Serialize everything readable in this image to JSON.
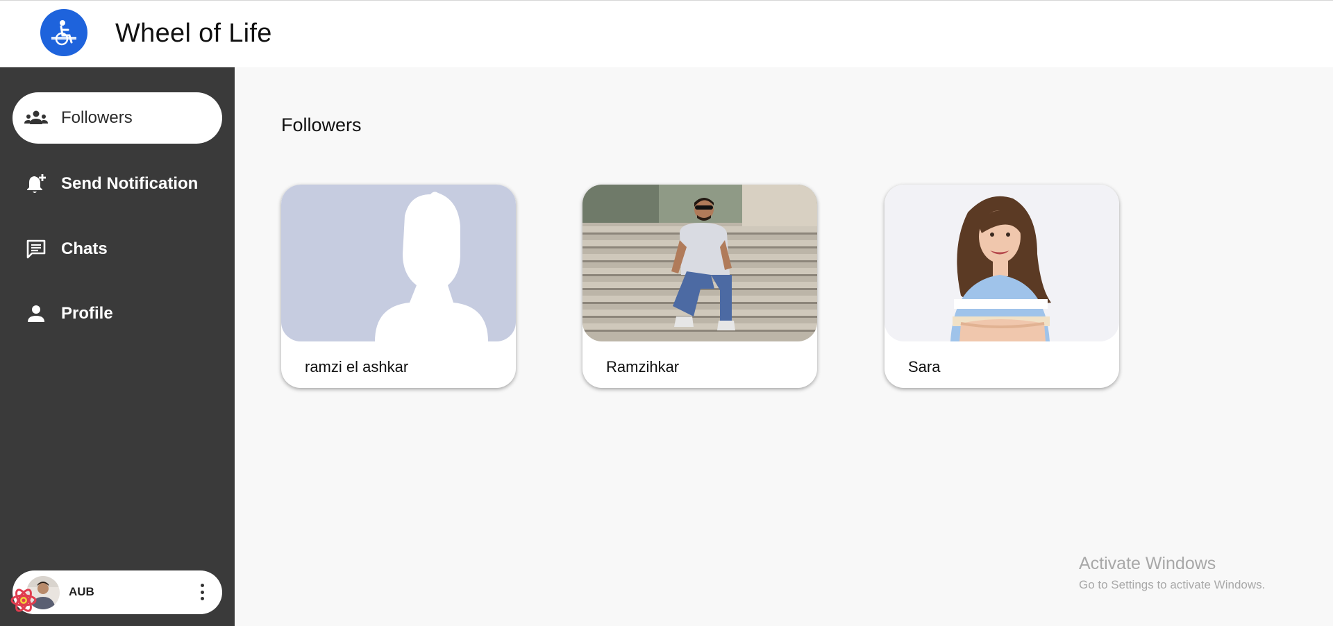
{
  "header": {
    "title": "Wheel of Life",
    "logo_icon": "wheelchair-logo-icon"
  },
  "sidebar": {
    "items": [
      {
        "label": "Followers",
        "icon": "group-icon",
        "active": true
      },
      {
        "label": "Send Notification",
        "icon": "bell-add-icon",
        "active": false
      },
      {
        "label": "Chats",
        "icon": "chat-icon",
        "active": false
      },
      {
        "label": "Profile",
        "icon": "person-icon",
        "active": false
      }
    ],
    "user": {
      "name": "AUB",
      "menu_icon": "more-vertical-icon"
    }
  },
  "main": {
    "title": "Followers",
    "followers": [
      {
        "name": "ramzi el ashkar",
        "photo": "default-silhouette"
      },
      {
        "name": "Ramzihkar",
        "photo": "man-on-steps"
      },
      {
        "name": "Sara",
        "photo": "smiling-woman"
      }
    ]
  },
  "watermark": {
    "line1": "Activate Windows",
    "line2": "Go to Settings to activate Windows."
  },
  "colors": {
    "accent": "#1e63dc",
    "sidebar": "#3a3a3a",
    "background": "#f8f8f8"
  }
}
